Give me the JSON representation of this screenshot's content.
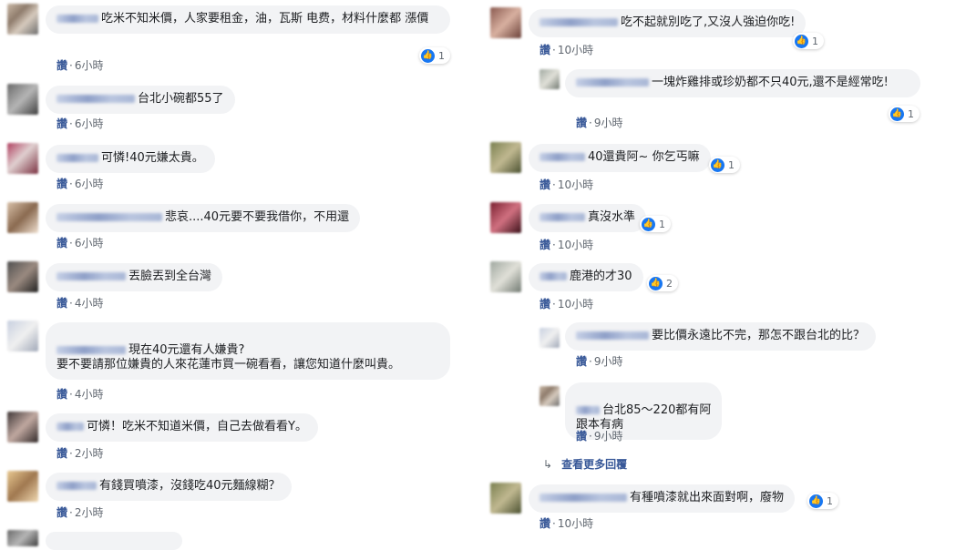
{
  "like_label": "讚",
  "left": [
    {
      "text": "吃米不知米價，人家要租金，油，瓦斯 电费，材料什麼都 漲價",
      "time": "6小時",
      "reactions": "1"
    },
    {
      "text": "台北小碗都55了",
      "time": "6小時",
      "reactions": ""
    },
    {
      "text": "可憐!40元嫌太貴。",
      "time": "6小時",
      "reactions": ""
    },
    {
      "text": "悲哀....40元要不要我借你，不用還",
      "time": "6小時",
      "reactions": ""
    },
    {
      "text": "丟臉丟到全台灣",
      "time": "4小時",
      "reactions": ""
    },
    {
      "text": "現在40元還有人嫌貴?\n要不要請那位嫌貴的人來花蓮市買一碗看看，讓您知道什麼叫貴。",
      "time": "4小時",
      "reactions": ""
    },
    {
      "text": "可憐！吃米不知道米價，自己去做看看Y。",
      "time": "2小時",
      "reactions": ""
    },
    {
      "text": "有錢買噴漆，沒錢吃40元麵線糊？",
      "time": "2小時",
      "reactions": ""
    }
  ],
  "right": [
    {
      "text": "吃不起就別吃了,又沒人強迫你吃!",
      "time": "10小時",
      "reactions": "1"
    },
    {
      "text": "一塊炸雞排或珍奶都不只40元,還不是經常吃!",
      "time": "9小時",
      "reactions": "1"
    },
    {
      "text": "40還貴阿~ 你乞丐嘛",
      "time": "10小時",
      "reactions": "1"
    },
    {
      "text": "真沒水準",
      "time": "10小時",
      "reactions": "1"
    },
    {
      "text": "鹿港的才30",
      "time": "10小時",
      "reactions": "2"
    },
    {
      "text": "要比價永遠比不完，那怎不跟台北的比？",
      "time": "9小時",
      "reactions": ""
    },
    {
      "text": "台北85～220都有阿\n跟本有病",
      "time": "9小時",
      "reactions": ""
    },
    {
      "text": "有種噴漆就出來面對啊，廢物",
      "time": "10小時",
      "reactions": "1"
    }
  ],
  "view_more_replies": "查看更多回覆",
  "icons": {
    "like": "like-thumb-icon",
    "reply_arrow": "reply-arrow-icon"
  }
}
